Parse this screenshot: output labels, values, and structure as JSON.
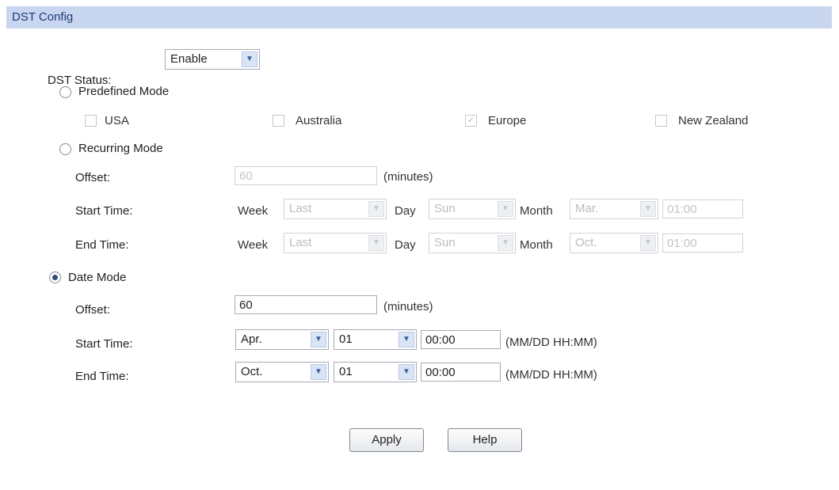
{
  "header": {
    "title": "DST Config"
  },
  "dst_status": {
    "label": "DST Status:",
    "value": "Enable"
  },
  "predefined": {
    "label": "Predefined Mode",
    "options": [
      {
        "label": "USA",
        "checked": false
      },
      {
        "label": "Australia",
        "checked": false
      },
      {
        "label": "Europe",
        "checked": true
      },
      {
        "label": "New Zealand",
        "checked": false
      }
    ]
  },
  "recurring": {
    "label": "Recurring Mode",
    "offset_label": "Offset:",
    "offset_value": "60",
    "offset_unit": "(minutes)",
    "week_label": "Week",
    "day_label": "Day",
    "month_label": "Month",
    "start": {
      "label": "Start Time:",
      "week": "Last",
      "day": "Sun",
      "month": "Mar.",
      "time": "01:00"
    },
    "end": {
      "label": "End Time:",
      "week": "Last",
      "day": "Sun",
      "month": "Oct.",
      "time": "01:00"
    }
  },
  "date_mode": {
    "label": "Date Mode",
    "selected": true,
    "offset_label": "Offset:",
    "offset_value": "60",
    "offset_unit": "(minutes)",
    "format_hint": "(MM/DD HH:MM)",
    "start": {
      "label": "Start Time:",
      "month": "Apr.",
      "day": "01",
      "time": "00:00"
    },
    "end": {
      "label": "End Time:",
      "month": "Oct.",
      "day": "01",
      "time": "00:00"
    }
  },
  "buttons": {
    "apply": "Apply",
    "help": "Help"
  }
}
